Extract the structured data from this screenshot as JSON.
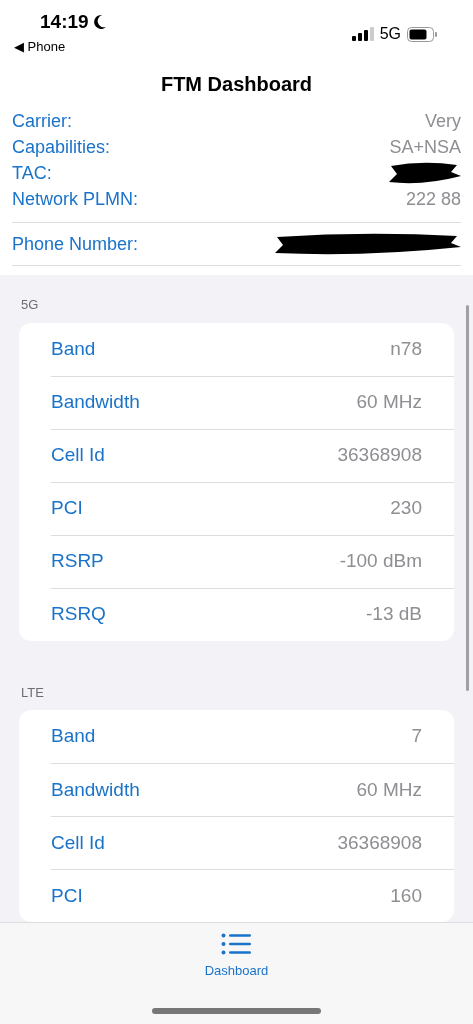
{
  "status_bar": {
    "time": "14:19",
    "back_link": "◀ Phone",
    "network": "5G"
  },
  "title": "FTM Dashboard",
  "info_rows": [
    {
      "label": "Carrier:",
      "value": "Very",
      "redacted": false
    },
    {
      "label": "Capabilities:",
      "value": "SA+NSA",
      "redacted": false
    },
    {
      "label": "TAC:",
      "redacted": true
    },
    {
      "label": "Network PLMN:",
      "value": "222 88",
      "redacted": false
    }
  ],
  "phone_row": {
    "label": "Phone Number:",
    "redacted": true
  },
  "sections": [
    {
      "header": "5G",
      "rows": [
        {
          "label": "Band",
          "value": "n78"
        },
        {
          "label": "Bandwidth",
          "value": "60 MHz"
        },
        {
          "label": "Cell Id",
          "value": "36368908"
        },
        {
          "label": "PCI",
          "value": "230"
        },
        {
          "label": "RSRP",
          "value": "-100 dBm"
        },
        {
          "label": "RSRQ",
          "value": "-13 dB"
        }
      ]
    },
    {
      "header": "LTE",
      "rows": [
        {
          "label": "Band",
          "value": "7"
        },
        {
          "label": "Bandwidth",
          "value": "60 MHz"
        },
        {
          "label": "Cell Id",
          "value": "36368908"
        },
        {
          "label": "PCI",
          "value": "160"
        }
      ]
    }
  ],
  "tab_bar": [
    {
      "label": "Dashboard",
      "selected": true
    }
  ]
}
